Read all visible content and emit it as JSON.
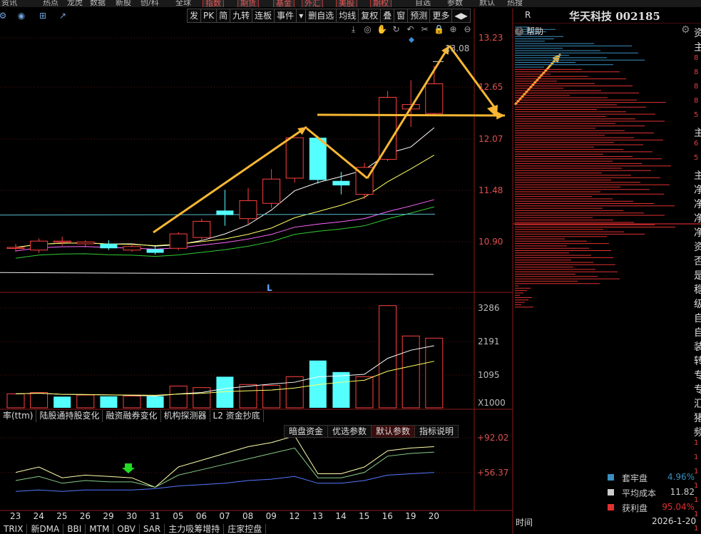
{
  "top_nav": [
    "资讯",
    "热点",
    "龙虎",
    "数据",
    "新股",
    "创/科",
    "全球",
    "指数",
    "期货",
    "基金",
    "外汇",
    "美股",
    "期权",
    "自选",
    "参数",
    "默认",
    "热搜"
  ],
  "toolbar_icons": [
    "gear-icon",
    "eye-icon",
    "grid-icon",
    "share-icon"
  ],
  "tabs": [
    "发",
    "PK",
    "简",
    "九转",
    "连板",
    "事件",
    "▾",
    "删自选",
    "均线",
    "复权",
    "叠",
    "窗",
    "预测",
    "更多",
    "◀▶"
  ],
  "chart_tools": [
    "pin-icon",
    "eye-icon",
    "hand-icon",
    "refresh-icon",
    "undo-icon",
    "scissors-icon",
    "lock-icon",
    "zoom-in-icon",
    "zoom-out-icon"
  ],
  "price_axis": [
    "13.23",
    "12.65",
    "12.07",
    "11.48",
    "10.90"
  ],
  "volume_axis": [
    "3286",
    "2191",
    "1095",
    "X1000"
  ],
  "indicator_axis": [
    "+92.02",
    "+56.37"
  ],
  "high_label": "13.08",
  "marker_label": "L",
  "right_panel": {
    "label": "R",
    "title": "华天科技 002185",
    "help": "帮助",
    "legend": [
      {
        "name": "套牢盘",
        "value": "4.96%",
        "color": "#3a8fc0",
        "value_color": "#3a8fc0"
      },
      {
        "name": "平均成本",
        "value": "11.82",
        "color": "#cccccc",
        "value_color": "#cccccc"
      },
      {
        "name": "获利盘",
        "value": "95.04%",
        "color": "#e03030",
        "value_color": "#e03030"
      }
    ],
    "footer_left": "时间",
    "footer_right": "2026-1-20"
  },
  "indicator_tabs": [
    "率(ttm)",
    "陆股通持股变化",
    "融资融券变化",
    "机构探测器",
    "L2 资金抄底"
  ],
  "param_tabs": [
    "暗盘资金",
    "优选参数",
    "默认参数",
    "指标说明"
  ],
  "dates": [
    "23",
    "24",
    "25",
    "26",
    "29",
    "30",
    "31",
    "05",
    "06",
    "07",
    "08",
    "09",
    "12",
    "13",
    "14",
    "15",
    "16",
    "19",
    "20"
  ],
  "bottom_tabs": [
    "TRIX",
    "新DMA",
    "BBI",
    "MTM",
    "OBV",
    "SAR",
    "主力吸筹增持",
    "庄家控盘"
  ],
  "right_edge_chars": [
    "资",
    "主",
    "8",
    "8",
    "8",
    "8",
    "5",
    "主",
    "6",
    "5",
    "主",
    "净",
    "净",
    "净",
    "净",
    "资",
    "否",
    "是",
    "稳",
    "级",
    "自",
    "自",
    "装",
    "转",
    "专",
    "专",
    "汇",
    "猪",
    "频",
    "1",
    "1",
    "1",
    "1",
    "1",
    "1",
    "1"
  ],
  "chart_data": {
    "type": "candlestick",
    "categories": [
      "23",
      "24",
      "25",
      "26",
      "29",
      "30",
      "31",
      "05",
      "06",
      "07",
      "08",
      "09",
      "12",
      "13",
      "14",
      "15",
      "16",
      "19",
      "20"
    ],
    "candles": [
      {
        "o": 11.06,
        "c": 11.06,
        "h": 11.1,
        "l": 11.01,
        "up": true
      },
      {
        "o": 11.03,
        "c": 11.13,
        "h": 11.16,
        "l": 11.0,
        "up": true
      },
      {
        "o": 11.13,
        "c": 11.13,
        "h": 11.18,
        "l": 11.08,
        "up": true
      },
      {
        "o": 11.1,
        "c": 11.12,
        "h": 11.14,
        "l": 11.06,
        "up": true
      },
      {
        "o": 11.1,
        "c": 11.05,
        "h": 11.14,
        "l": 11.03,
        "up": false
      },
      {
        "o": 11.03,
        "c": 11.07,
        "h": 11.1,
        "l": 11.01,
        "up": true
      },
      {
        "o": 11.04,
        "c": 11.0,
        "h": 11.07,
        "l": 10.98,
        "up": false
      },
      {
        "o": 11.05,
        "c": 11.21,
        "h": 11.23,
        "l": 11.03,
        "up": true
      },
      {
        "o": 11.17,
        "c": 11.35,
        "h": 11.38,
        "l": 11.12,
        "up": true
      },
      {
        "o": 11.47,
        "c": 11.42,
        "h": 11.7,
        "l": 11.3,
        "up": false
      },
      {
        "o": 11.38,
        "c": 11.58,
        "h": 11.72,
        "l": 11.32,
        "up": true
      },
      {
        "o": 11.55,
        "c": 11.82,
        "h": 11.93,
        "l": 11.5,
        "up": true
      },
      {
        "o": 11.83,
        "c": 12.28,
        "h": 12.28,
        "l": 11.78,
        "up": true
      },
      {
        "o": 12.28,
        "c": 11.81,
        "h": 12.3,
        "l": 11.77,
        "up": false
      },
      {
        "o": 11.8,
        "c": 11.75,
        "h": 11.9,
        "l": 11.65,
        "up": false
      },
      {
        "o": 11.65,
        "c": 11.95,
        "h": 12.0,
        "l": 11.6,
        "up": true
      },
      {
        "o": 12.04,
        "c": 12.73,
        "h": 12.8,
        "l": 12.02,
        "up": true
      },
      {
        "o": 12.6,
        "c": 12.65,
        "h": 12.92,
        "l": 12.4,
        "up": true
      },
      {
        "o": 12.55,
        "c": 12.88,
        "h": 13.08,
        "l": 12.52,
        "up": true
      }
    ],
    "volume": [
      450,
      490,
      360,
      410,
      370,
      380,
      370,
      700,
      650,
      1000,
      750,
      720,
      1000,
      1520,
      1150,
      1000,
      3286,
      2310,
      2240
    ],
    "volume_up": [
      true,
      true,
      false,
      true,
      false,
      true,
      false,
      true,
      true,
      false,
      true,
      true,
      true,
      false,
      false,
      true,
      true,
      true,
      true
    ],
    "price_ylim": [
      10.6,
      13.4
    ],
    "volume_ylim": [
      0,
      3600
    ],
    "indicator_ylim": [
      40,
      100
    ],
    "high_marker": 13.08
  }
}
